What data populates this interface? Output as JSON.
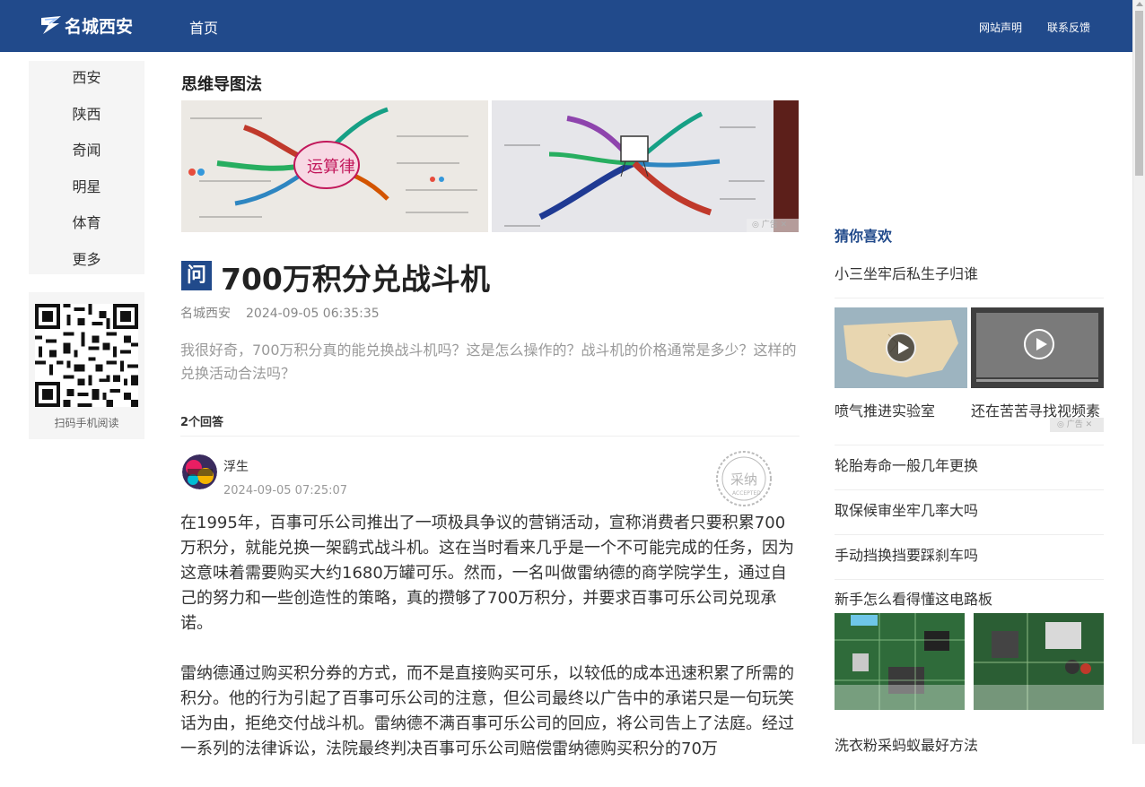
{
  "header": {
    "logo_text": "名城西安",
    "nav_home": "首页",
    "links": [
      "网站声明",
      "联系反馈"
    ]
  },
  "leftnav": {
    "items": [
      "西安",
      "陕西",
      "奇闻",
      "明星",
      "体育",
      "更多"
    ],
    "qr_caption": "扫码手机阅读"
  },
  "main": {
    "section_title": "思维导图法",
    "banner_ad_tag": "广告",
    "banner_text_left": "运算律",
    "question_badge": "问",
    "question_title": "700万积分兑战斗机",
    "author": "名城西安",
    "date": "2024-09-05 06:35:35",
    "description": "我很好奇，700万积分真的能兑换战斗机吗？这是怎么操作的？战斗机的价格通常是多少？这样的兑换活动合法吗？",
    "answer_count": "2个回答",
    "answer": {
      "name": "浮生",
      "time": "2024-09-05 07:25:07",
      "stamp_text": "采纳",
      "stamp_sub": "ACCEPTED",
      "paragraphs": [
        "在1995年，百事可乐公司推出了一项极具争议的营销活动，宣称消费者只要积累700万积分，就能兑换一架鹞式战斗机。这在当时看来几乎是一个不可能完成的任务，因为这意味着需要购买大约1680万罐可乐。然而，一名叫做雷纳德的商学院学生，通过自己的努力和一些创造性的策略，真的攒够了700万积分，并要求百事可乐公司兑现承诺。",
        "雷纳德通过购买积分券的方式，而不是直接购买可乐，以较低的成本迅速积累了所需的积分。他的行为引起了百事可乐公司的注意，但公司最终以广告中的承诺只是一句玩笑话为由，拒绝交付战斗机。雷纳德不满百事可乐公司的回应，将公司告上了法庭。经过一系列的法律诉讼，法院最终判决百事可乐公司赔偿雷纳德购买积分的70万"
      ]
    }
  },
  "right": {
    "title": "猜你喜欢",
    "first_item": "小三坐牢后私生子归谁",
    "video_captions": [
      "喷气推进实验室",
      "还在苦苦寻找视频素"
    ],
    "ad_tag": "广告",
    "items": [
      "轮胎寿命一般几年更换",
      "取保候审坐牢几率大吗",
      "手动挡换挡要踩刹车吗",
      "新手怎么看得懂这电路板"
    ],
    "last_item": "洗衣粉采蚂蚁最好方法"
  }
}
